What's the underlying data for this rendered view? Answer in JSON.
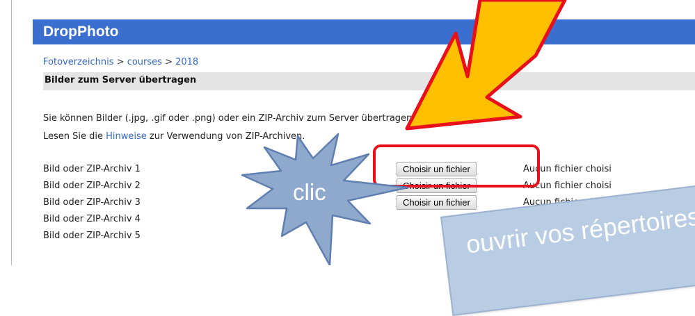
{
  "app": {
    "title": "DropPhoto"
  },
  "breadcrumb": {
    "items": [
      "Fotoverzeichnis",
      "courses",
      "2018"
    ],
    "separator": ">"
  },
  "section": {
    "title": "Bilder zum Server übertragen"
  },
  "intro": {
    "line1": "Sie können Bilder (.jpg, .gif oder .png) oder ein ZIP-Archiv zum Server übertragen. Komprimi",
    "line2_before": "Lesen Sie die ",
    "line2_link": "Hinweise",
    "line2_after": " zur Verwendung von ZIP-Archiven."
  },
  "upload_rows": [
    {
      "label": "Bild oder ZIP-Archiv 1",
      "button": "Choisir un fichier",
      "status": "Aucun fichier choisi"
    },
    {
      "label": "Bild oder ZIP-Archiv 2",
      "button": "Choisir un fichier",
      "status": "Aucun fichier choisi"
    },
    {
      "label": "Bild oder ZIP-Archiv 3",
      "button": "Choisir un fichier",
      "status": "Aucun fichier choisi"
    },
    {
      "label": "Bild oder ZIP-Archiv 4"
    },
    {
      "label": "Bild oder ZIP-Archiv 5"
    }
  ],
  "annotations": {
    "callout": "clic",
    "note": "ouvrir vos répertoires,",
    "colors": {
      "header": "#3a6fd0",
      "callout_fill": "#8fa9cd",
      "arrow_fill": "#ffc000",
      "highlight": "#e8101a",
      "note_fill": "#b8cce4"
    }
  }
}
